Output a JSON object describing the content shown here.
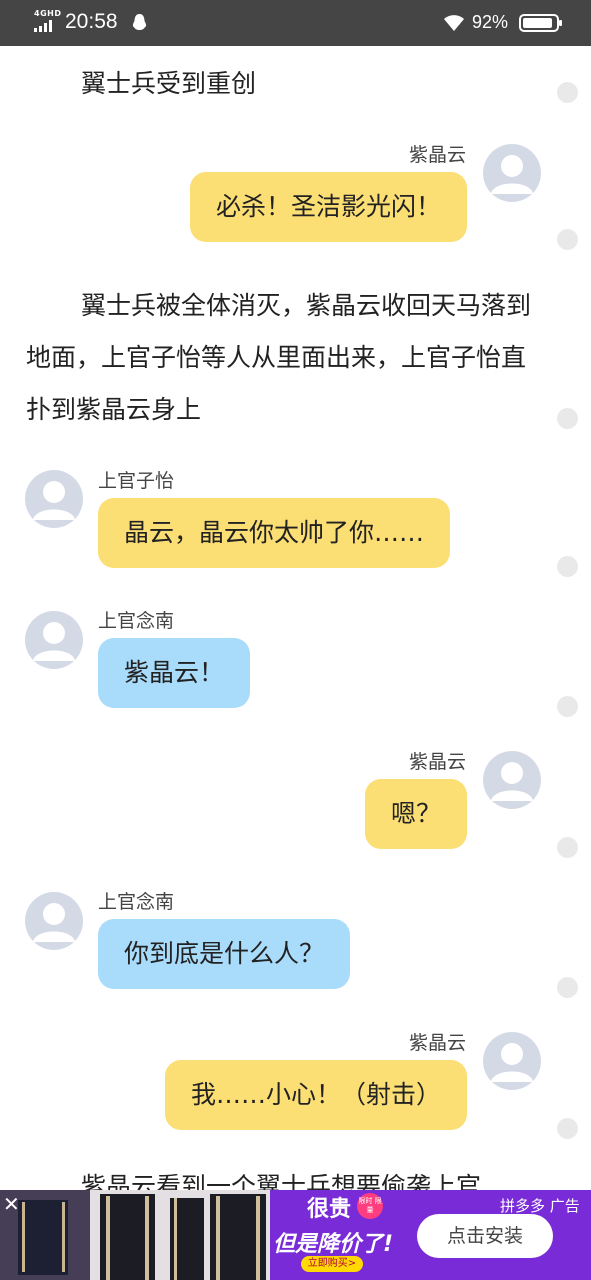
{
  "status_bar": {
    "network": "4GHD",
    "time": "20:58",
    "battery_text": "92%",
    "battery_level": 0.92
  },
  "story": {
    "para1": "翼士兵受到重创",
    "para2": "翼士兵被全体消灭，紫晶云收回天马落到地面，上官子怡等人从里面出来，上官子怡直扑到紫晶云身上",
    "para3": "紫晶云看到一个翼士兵想要偷袭上官"
  },
  "messages": [
    {
      "speaker": "紫晶云",
      "text": "必杀！圣洁影光闪！",
      "side": "right",
      "color": "yellow"
    },
    {
      "speaker": "上官子怡",
      "text": "晶云，晶云你太帅了你……",
      "side": "left",
      "color": "yellow"
    },
    {
      "speaker": "上官念南",
      "text": "紫晶云！",
      "side": "left",
      "color": "blue"
    },
    {
      "speaker": "紫晶云",
      "text": "嗯？",
      "side": "right",
      "color": "yellow"
    },
    {
      "speaker": "上官念南",
      "text": "你到底是什么人？",
      "side": "left",
      "color": "blue"
    },
    {
      "speaker": "紫晶云",
      "text": "我……小心！（射击）",
      "side": "right",
      "color": "yellow"
    }
  ],
  "ad": {
    "close_icon": "✕",
    "headline1": "很贵",
    "tag": "限时 限量",
    "headline2": "但是降价了!",
    "small_button": "立即购买>",
    "brand": "拼多多 广告",
    "install_button": "点击安装"
  },
  "colors": {
    "status_bar": "#454545",
    "bubble_yellow": "#fcdf74",
    "bubble_blue": "#a9dcfb",
    "ad_background": "#7a2bd8"
  }
}
